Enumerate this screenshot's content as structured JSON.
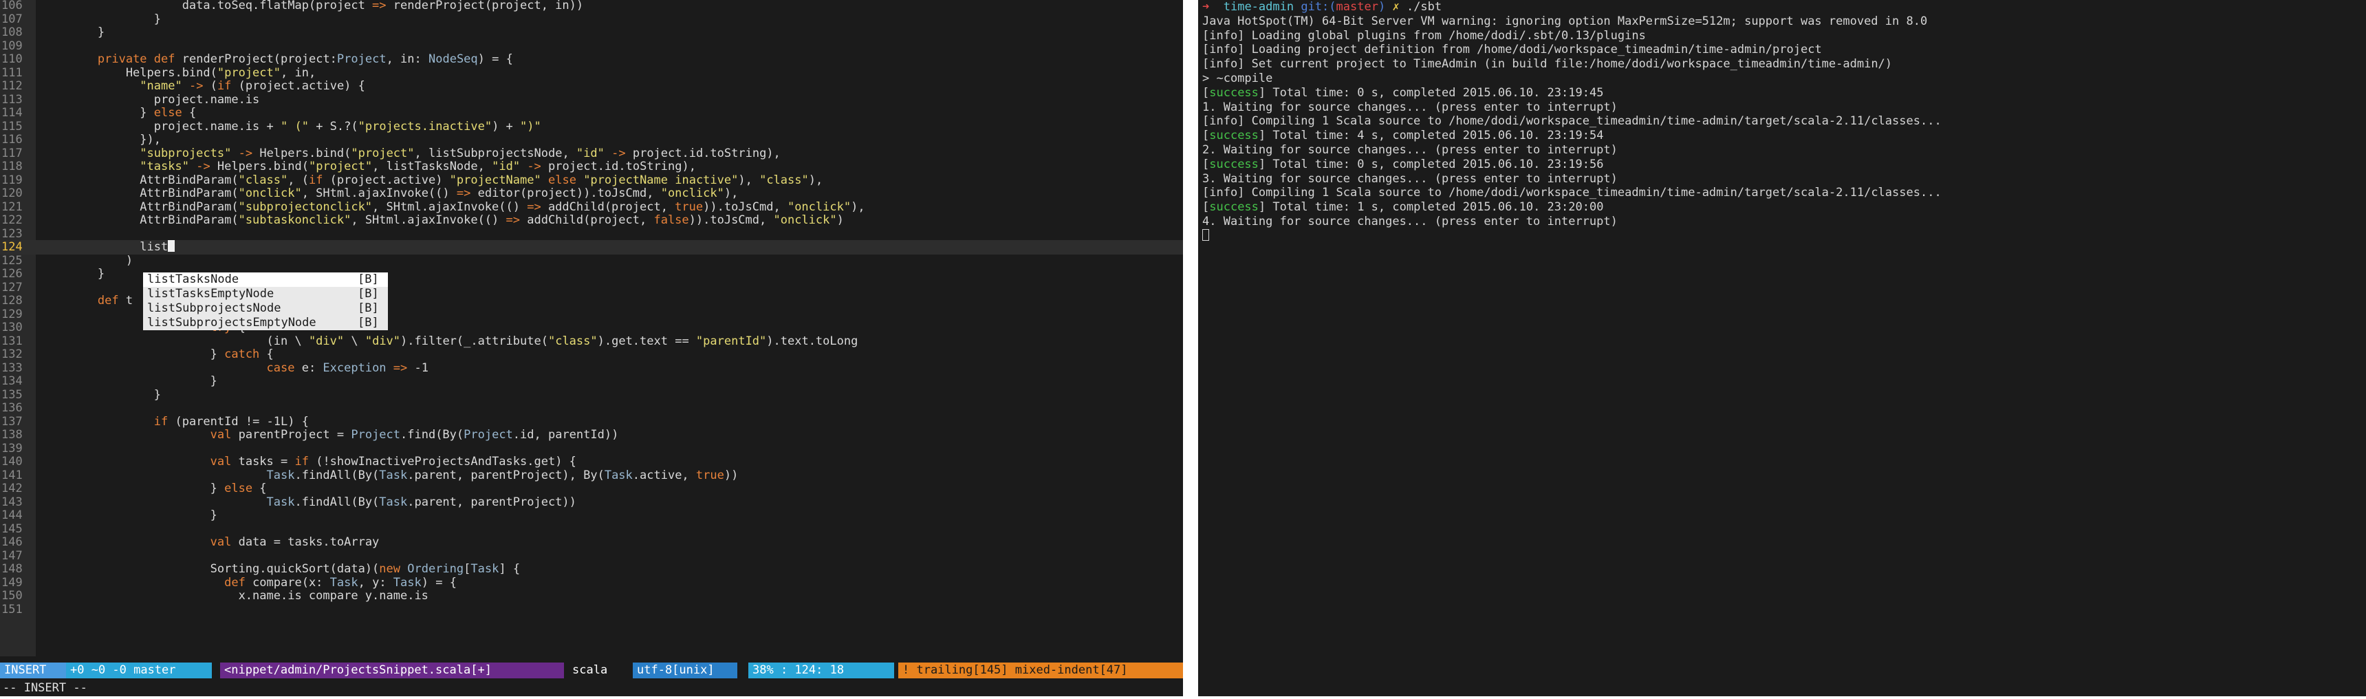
{
  "editor": {
    "lines": [
      {
        "n": "106",
        "html": "                    data.toSeq.flatMap(project => renderProject(project, in))"
      },
      {
        "n": "107",
        "html": "                }"
      },
      {
        "n": "108",
        "html": "        }"
      },
      {
        "n": "109",
        "html": ""
      },
      {
        "n": "110",
        "html": "        private def renderProject(project:Project, in: NodeSeq) = {"
      },
      {
        "n": "111",
        "html": "            Helpers.bind(\"project\", in,"
      },
      {
        "n": "112",
        "html": "              \"name\" -> (if (project.active) {"
      },
      {
        "n": "113",
        "html": "                project.name.is"
      },
      {
        "n": "114",
        "html": "              } else {"
      },
      {
        "n": "115",
        "html": "                project.name.is + \" (\" + S.?(\"projects.inactive\") + \")\""
      },
      {
        "n": "116",
        "html": "              }),"
      },
      {
        "n": "117",
        "html": "              \"subprojects\" -> Helpers.bind(\"project\", listSubprojectsNode, \"id\" -> project.id.toString),"
      },
      {
        "n": "118",
        "html": "              \"tasks\" -> Helpers.bind(\"project\", listTasksNode, \"id\" -> project.id.toString),"
      },
      {
        "n": "119",
        "html": "              AttrBindParam(\"class\", (if (project.active) \"projectName\" else \"projectName inactive\"), \"class\"),"
      },
      {
        "n": "120",
        "html": "              AttrBindParam(\"onclick\", SHtml.ajaxInvoke(() => editor(project)).toJsCmd, \"onclick\"),"
      },
      {
        "n": "121",
        "html": "              AttrBindParam(\"subprojectonclick\", SHtml.ajaxInvoke(() => addChild(project, true)).toJsCmd, \"onclick\"),"
      },
      {
        "n": "122",
        "html": "              AttrBindParam(\"subtaskonclick\", SHtml.ajaxInvoke(() => addChild(project, false)).toJsCmd, \"onclick\")"
      },
      {
        "n": "123",
        "html": ""
      },
      {
        "n": "124",
        "html": "              list"
      },
      {
        "n": "125",
        "html": "            )"
      },
      {
        "n": "126",
        "html": "        }"
      },
      {
        "n": "127",
        "html": ""
      },
      {
        "n": "128",
        "html": "        def t"
      },
      {
        "n": "129",
        "html": "                val parentId: Long = {"
      },
      {
        "n": "130",
        "html": "                        try {"
      },
      {
        "n": "131",
        "html": "                                (in \\ \"div\" \\ \"div\").filter(_.attribute(\"class\").get.text == \"parentId\").text.toLong"
      },
      {
        "n": "132",
        "html": "                        } catch {"
      },
      {
        "n": "133",
        "html": "                                case e: Exception => -1"
      },
      {
        "n": "134",
        "html": "                        }"
      },
      {
        "n": "135",
        "html": "                }"
      },
      {
        "n": "136",
        "html": ""
      },
      {
        "n": "137",
        "html": "                if (parentId != -1L) {"
      },
      {
        "n": "138",
        "html": "                        val parentProject = Project.find(By(Project.id, parentId))"
      },
      {
        "n": "139",
        "html": ""
      },
      {
        "n": "140",
        "html": "                        val tasks = if (!showInactiveProjectsAndTasks.get) {"
      },
      {
        "n": "141",
        "html": "                                Task.findAll(By(Task.parent, parentProject), By(Task.active, true))"
      },
      {
        "n": "142",
        "html": "                        } else {"
      },
      {
        "n": "143",
        "html": "                                Task.findAll(By(Task.parent, parentProject))"
      },
      {
        "n": "144",
        "html": "                        }"
      },
      {
        "n": "145",
        "html": ""
      },
      {
        "n": "146",
        "html": "                        val data = tasks.toArray"
      },
      {
        "n": "147",
        "html": ""
      },
      {
        "n": "148",
        "html": "                        Sorting.quickSort(data)(new Ordering[Task] {"
      },
      {
        "n": "149",
        "html": "                          def compare(x: Task, y: Task) = {"
      },
      {
        "n": "150",
        "html": "                            x.name.is compare y.name.is"
      },
      {
        "n": "151",
        "html": ""
      }
    ],
    "completion": [
      {
        "word": "listTasksNode",
        "kind": "[B]"
      },
      {
        "word": "listTasksEmptyNode",
        "kind": "[B]"
      },
      {
        "word": "listSubprojectsNode",
        "kind": "[B]"
      },
      {
        "word": "listSubprojectsEmptyNode",
        "kind": "[B]"
      }
    ],
    "status": {
      "mode": "INSERT",
      "git": "+0 ~0 -0 master",
      "file": "<nippet/admin/ProjectsSnippet.scala[+]",
      "filetype": "scala",
      "encoding": "utf-8[unix]",
      "position": "38% : 124: 18",
      "warnings": "! trailing[145] mixed-indent[47]"
    },
    "cmdline": "-- INSERT --"
  },
  "terminal": {
    "prompt_dir": "time-admin",
    "prompt_git": "git:(",
    "prompt_branch": "master",
    "prompt_git_close": ")",
    "prompt_dirty": "✗",
    "prompt_cmd": "./sbt",
    "lines": [
      {
        "tag": "",
        "text": "Java HotSpot(TM) 64-Bit Server VM warning: ignoring option MaxPermSize=512m; support was removed in 8.0"
      },
      {
        "tag": "info",
        "text": " Loading global plugins from /home/dodi/.sbt/0.13/plugins"
      },
      {
        "tag": "info",
        "text": " Loading project definition from /home/dodi/workspace_timeadmin/time-admin/project"
      },
      {
        "tag": "info",
        "text": " Set current project to TimeAdmin (in build file:/home/dodi/workspace_timeadmin/time-admin/)"
      },
      {
        "tag": "",
        "text": "> ~compile"
      },
      {
        "tag": "success",
        "text": " Total time: 0 s, completed 2015.06.10. 23:19:45"
      },
      {
        "tag": "",
        "text": "1. Waiting for source changes... (press enter to interrupt)"
      },
      {
        "tag": "info",
        "text": " Compiling 1 Scala source to /home/dodi/workspace_timeadmin/time-admin/target/scala-2.11/classes..."
      },
      {
        "tag": "success",
        "text": " Total time: 4 s, completed 2015.06.10. 23:19:54"
      },
      {
        "tag": "",
        "text": "2. Waiting for source changes... (press enter to interrupt)"
      },
      {
        "tag": "success",
        "text": " Total time: 0 s, completed 2015.06.10. 23:19:56"
      },
      {
        "tag": "",
        "text": "3. Waiting for source changes... (press enter to interrupt)"
      },
      {
        "tag": "info",
        "text": " Compiling 1 Scala source to /home/dodi/workspace_timeadmin/time-admin/target/scala-2.11/classes..."
      },
      {
        "tag": "success",
        "text": " Total time: 1 s, completed 2015.06.10. 23:20:00"
      },
      {
        "tag": "",
        "text": "4. Waiting for source changes... (press enter to interrupt)"
      }
    ]
  }
}
